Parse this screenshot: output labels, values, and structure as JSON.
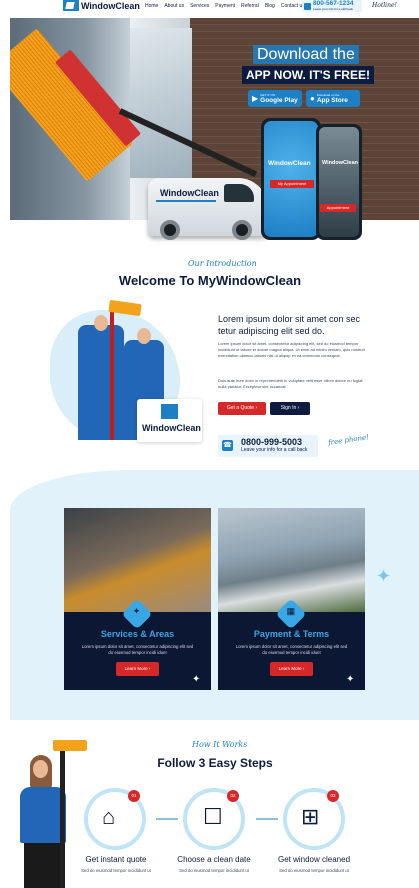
{
  "header": {
    "brand": "WindowClean",
    "nav": [
      "Home",
      "About us",
      "Services",
      "Payment",
      "Referral",
      "Blog",
      "Contact us"
    ],
    "phone": "800-567-1234",
    "phone_sub": "Leave your info for a call back",
    "hotline": "Hotline!"
  },
  "hero": {
    "title": "Download the",
    "subtitle": "APP NOW. IT'S FREE!",
    "google_top": "GET IT ON",
    "google_label": "Google Play",
    "apple_top": "Download on the",
    "apple_label": "App Store",
    "van_text": "WindowClean",
    "phone_logo": "WindowClean",
    "phone_button": "My Appointment",
    "phone2_logo": "WindowClean",
    "phone2_button": "Appointment"
  },
  "intro": {
    "script": "Our Introduction",
    "title": "Welcome To MyWindowClean",
    "lead": "Lorem ipsum dolor sit amet con sec tetur adipiscing elit sed do.",
    "para1": "Lorem ipsum dolor sit amet, consectetur adipiscing elit, sed do eiusmod tempor incididunt ut labore et dolore magna aliqua. Ut enim ad minim veniam, quis nostrud exercitation ullamco laboris nisi ut aliquip ex ea commodo consequat.",
    "para2": "Duis aute irure dolor in reprehenderit in voluptate velit esse cillum dolore eu fugiat nulla pariatur. Excepteur sint occaecat",
    "quote_button": "Get a Quote ›",
    "signin_button": "Sign In ›",
    "call_number": "0800-999-5003",
    "call_sub": "Leave your info for a call back",
    "free_phone": "free phone!",
    "badge_logo": "WindowClean"
  },
  "services": {
    "cards": [
      {
        "title": "Services & Areas",
        "desc": "Lorem ipsum dolor sit amet, consectetur adipiscing elit sed do eiusmod tempor incidi idunt",
        "button": "Learn More ›",
        "icon": "brush-icon"
      },
      {
        "title": "Payment & Terms",
        "desc": "Lorem ipsum dolor sit amet, consectetur adipiscing elit sed do eiusmod tempor incidi idunt",
        "button": "Learn More ›",
        "icon": "payment-icon"
      }
    ]
  },
  "steps": {
    "script": "How It Works",
    "title": "Follow 3 Easy Steps",
    "items": [
      {
        "num": "01",
        "title": "Get instant quote",
        "desc": "Sed do eiusmod tempor incididunt ut",
        "icon": "house-icon"
      },
      {
        "num": "02",
        "title": "Choose a clean date",
        "desc": "Sed do eiusmod tempor incididunt ut",
        "icon": "phone-tap-icon"
      },
      {
        "num": "03",
        "title": "Get window cleaned",
        "desc": "Sed do eiusmod tempor incididunt ut",
        "icon": "window-icon"
      }
    ]
  },
  "colors": {
    "primary": "#1d7fc4",
    "navy": "#0d1b3e",
    "accent": "#d62828",
    "light": "#e1f2fb"
  }
}
